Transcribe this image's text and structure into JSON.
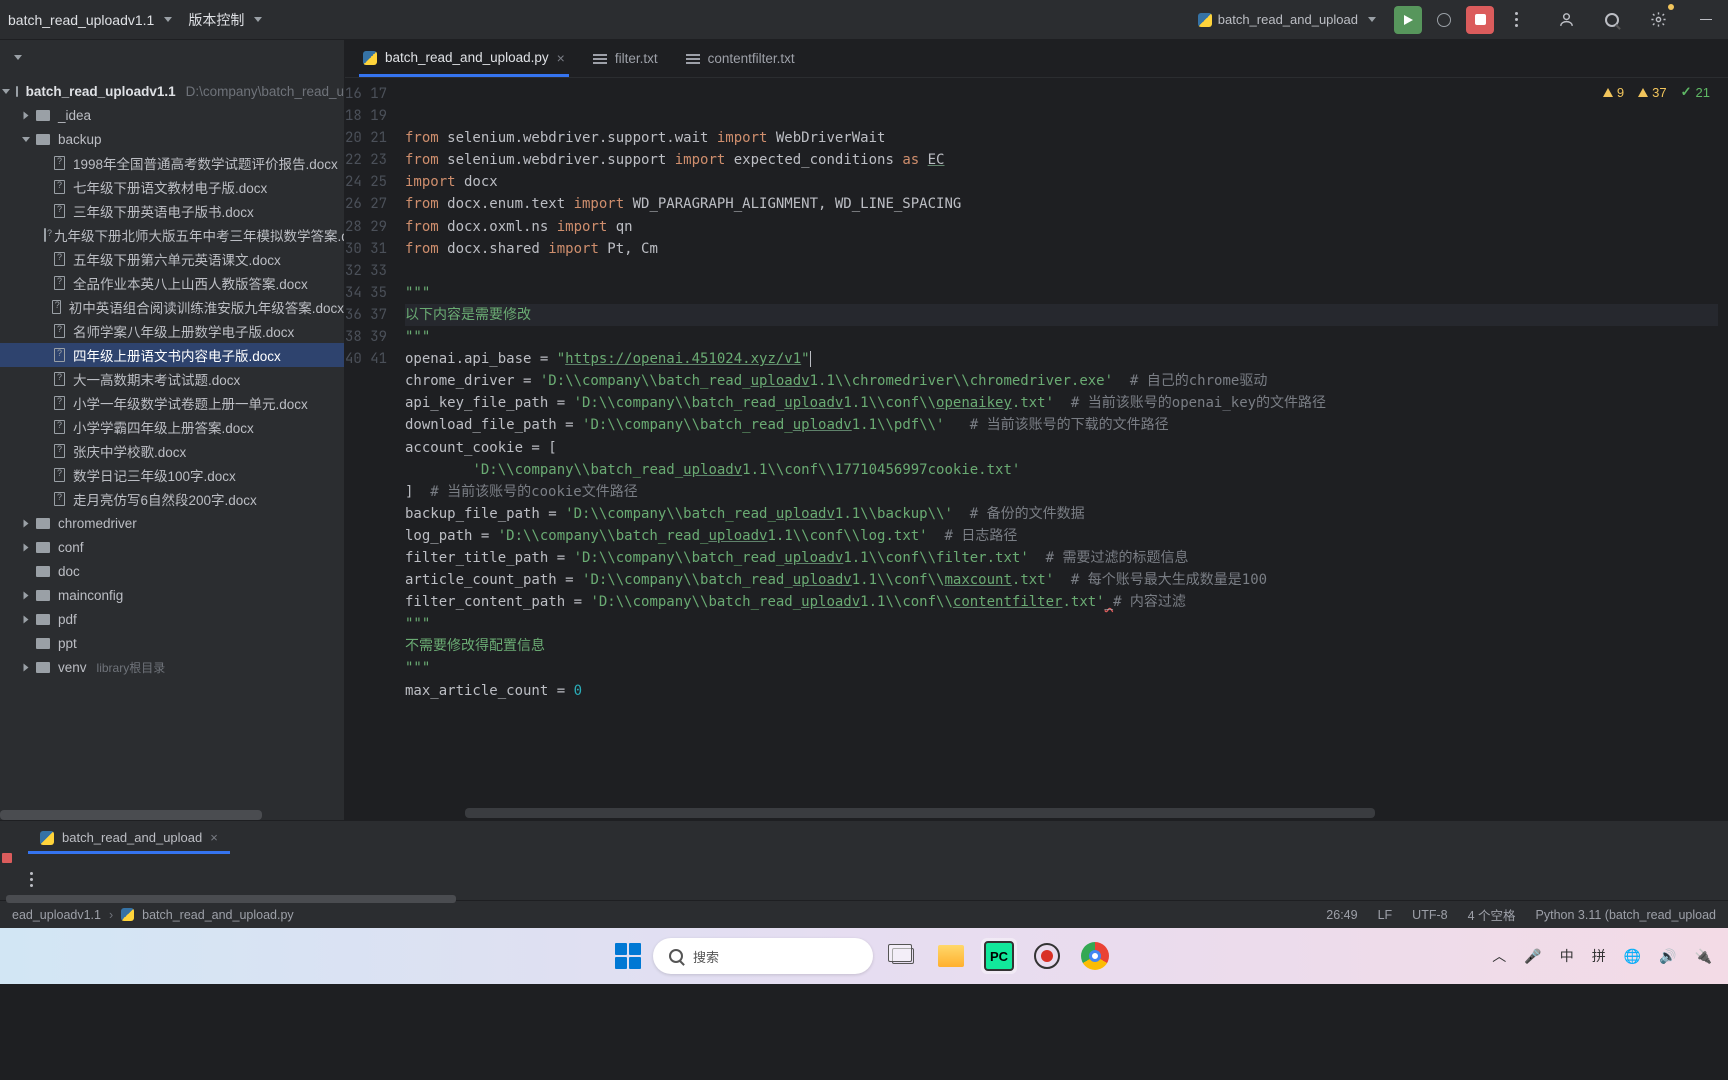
{
  "topbar": {
    "project": "batch_read_uploadv1.1",
    "vcs": "版本控制",
    "run_config": "batch_read_and_upload"
  },
  "sidebar": {
    "root": "batch_read_uploadv1.1",
    "root_path": "D:\\company\\batch_read_u",
    "tree": [
      {
        "lvl": 1,
        "exp": false,
        "type": "folder",
        "name": "_idea"
      },
      {
        "lvl": 1,
        "exp": true,
        "type": "folder",
        "name": "backup"
      },
      {
        "lvl": 2,
        "type": "doc",
        "name": "1998年全国普通高考数学试题评价报告.docx"
      },
      {
        "lvl": 2,
        "type": "doc",
        "name": "七年级下册语文教材电子版.docx"
      },
      {
        "lvl": 2,
        "type": "doc",
        "name": "三年级下册英语电子版书.docx"
      },
      {
        "lvl": 2,
        "type": "doc",
        "name": "九年级下册北师大版五年中考三年模拟数学答案.do"
      },
      {
        "lvl": 2,
        "type": "doc",
        "name": "五年级下册第六单元英语课文.docx"
      },
      {
        "lvl": 2,
        "type": "doc",
        "name": "全品作业本英八上山西人教版答案.docx"
      },
      {
        "lvl": 2,
        "type": "doc",
        "name": "初中英语组合阅读训练淮安版九年级答案.docx"
      },
      {
        "lvl": 2,
        "type": "doc",
        "name": "名师学案八年级上册数学电子版.docx"
      },
      {
        "lvl": 2,
        "type": "doc",
        "name": "四年级上册语文书内容电子版.docx",
        "sel": true
      },
      {
        "lvl": 2,
        "type": "doc",
        "name": "大一高数期末考试试题.docx"
      },
      {
        "lvl": 2,
        "type": "doc",
        "name": "小学一年级数学试卷题上册一单元.docx"
      },
      {
        "lvl": 2,
        "type": "doc",
        "name": "小学学霸四年级上册答案.docx"
      },
      {
        "lvl": 2,
        "type": "doc",
        "name": "张庆中学校歌.docx"
      },
      {
        "lvl": 2,
        "type": "doc",
        "name": "数学日记三年级100字.docx"
      },
      {
        "lvl": 2,
        "type": "doc",
        "name": "走月亮仿写6自然段200字.docx"
      },
      {
        "lvl": 1,
        "exp": false,
        "type": "folder",
        "name": "chromedriver"
      },
      {
        "lvl": 1,
        "exp": false,
        "type": "folder",
        "name": "conf"
      },
      {
        "lvl": 1,
        "type": "folder",
        "name": "doc"
      },
      {
        "lvl": 1,
        "exp": false,
        "type": "folder",
        "name": "mainconfig"
      },
      {
        "lvl": 1,
        "exp": false,
        "type": "folder",
        "name": "pdf"
      },
      {
        "lvl": 1,
        "type": "folder",
        "name": "ppt"
      },
      {
        "lvl": 1,
        "exp": false,
        "type": "folder",
        "name": "venv",
        "hint": "library根目录"
      }
    ]
  },
  "tabs": [
    {
      "name": "batch_read_and_upload.py",
      "icon": "py",
      "active": true,
      "close": true
    },
    {
      "name": "filter.txt",
      "icon": "txt"
    },
    {
      "name": "contentfilter.txt",
      "icon": "txt"
    }
  ],
  "inspect": {
    "errors": "9",
    "warnings": "37",
    "ok": "21"
  },
  "gutter_start": 16,
  "gutter_count": 26,
  "bottom_tab": "batch_read_and_upload",
  "breadcrumb": {
    "a": "ead_uploadv1.1",
    "b": "batch_read_and_upload.py"
  },
  "status": {
    "pos": "26:49",
    "le": "LF",
    "enc": "UTF-8",
    "indent": "4 个空格",
    "py": "Python 3.11 (batch_read_upload"
  },
  "taskbar": {
    "search": "搜索",
    "ime1": "中",
    "ime2": "拼"
  },
  "code": {
    "l16": {
      "pre": "from",
      "a": " selenium.webdriver.support.wait ",
      "imp": "import",
      "b": " WebDriverWait"
    },
    "l17": {
      "pre": "from",
      "a": " selenium.webdriver.support ",
      "imp": "import",
      "b": " expected_conditions ",
      "as": "as",
      "c": " ",
      "ec": "EC"
    },
    "l18": {
      "imp": "import",
      "a": " docx"
    },
    "l19": {
      "pre": "from",
      "a": " docx.enum.text ",
      "imp": "import",
      "b": " WD_PARAGRAPH_ALIGNMENT, WD_LINE_SPACING"
    },
    "l20": {
      "pre": "from",
      "a": " docx.oxml.ns ",
      "imp": "import",
      "b": " qn"
    },
    "l21": {
      "pre": "from",
      "a": " docx.shared ",
      "imp": "import",
      "b": " Pt, Cm"
    },
    "l23": "\"\"\"",
    "l24": "以下内容是需要修改",
    "l25": "\"\"\"",
    "l26": {
      "a": "openai.api_base = ",
      "s": "\"",
      "u": "https://openai.451024.xyz/v1",
      "e": "\""
    },
    "l27": {
      "a": "chrome_driver = ",
      "s": "'D:\\\\company\\\\batch_read_",
      "u": "uploadv",
      "s2": "1.1\\\\chromedriver\\\\chromedriver.exe'",
      "c": "  # 自己的chrome驱动"
    },
    "l28": {
      "a": "api_key_file_path = ",
      "s": "'D:\\\\company\\\\batch_read_",
      "u": "uploadv",
      "s2": "1.1\\\\conf\\\\",
      "u2": "openaikey",
      "s3": ".txt'",
      "c": "  # 当前该账号的openai_key的文件路径"
    },
    "l29": {
      "a": "download_file_path = ",
      "s": "'D:\\\\company\\\\batch_read_",
      "u": "uploadv",
      "s2": "1.1\\\\pdf\\\\'",
      "c": "   # 当前该账号的下载的文件路径"
    },
    "l30": "account_cookie = [",
    "l31": {
      "pad": "        ",
      "s": "'D:\\\\company\\\\batch_read_",
      "u": "uploadv",
      "s2": "1.1\\\\conf\\\\17710456997cookie.txt'"
    },
    "l32": {
      "a": "]  ",
      "c": "# 当前该账号的cookie文件路径"
    },
    "l33": {
      "a": "backup_file_path = ",
      "s": "'D:\\\\company\\\\batch_read_",
      "u": "uploadv",
      "s2": "1.1\\\\backup\\\\'",
      "c": "  # 备份的文件数据"
    },
    "l34": {
      "a": "log_path = ",
      "s": "'D:\\\\company\\\\batch_read_",
      "u": "uploadv",
      "s2": "1.1\\\\conf\\\\log.txt'",
      "c": "  # 日志路径"
    },
    "l35": {
      "a": "filter_title_path = ",
      "s": "'D:\\\\company\\\\batch_read_",
      "u": "uploadv",
      "s2": "1.1\\\\conf\\\\filter.txt'",
      "c": "  # 需要过滤的标题信息"
    },
    "l36": {
      "a": "article_count_path = ",
      "s": "'D:\\\\company\\\\batch_read_",
      "u": "uploadv",
      "s2": "1.1\\\\conf\\\\",
      "u2": "maxcount",
      "s3": ".txt'",
      "c": "  # 每个账号最大生成数量是100"
    },
    "l37": {
      "a": "filter_content_path = ",
      "s": "'D:\\\\company\\\\batch_read_",
      "u": "uploadv",
      "s2": "1.1\\\\conf\\\\",
      "u2": "contentfilter",
      "s3": ".txt'",
      "w": "_",
      "c": "# 内容过滤"
    },
    "l38": "\"\"\"",
    "l39": "不需要修改得配置信息",
    "l40": "\"\"\"",
    "l41": {
      "a": "max_article_count = ",
      "n": "0"
    }
  }
}
